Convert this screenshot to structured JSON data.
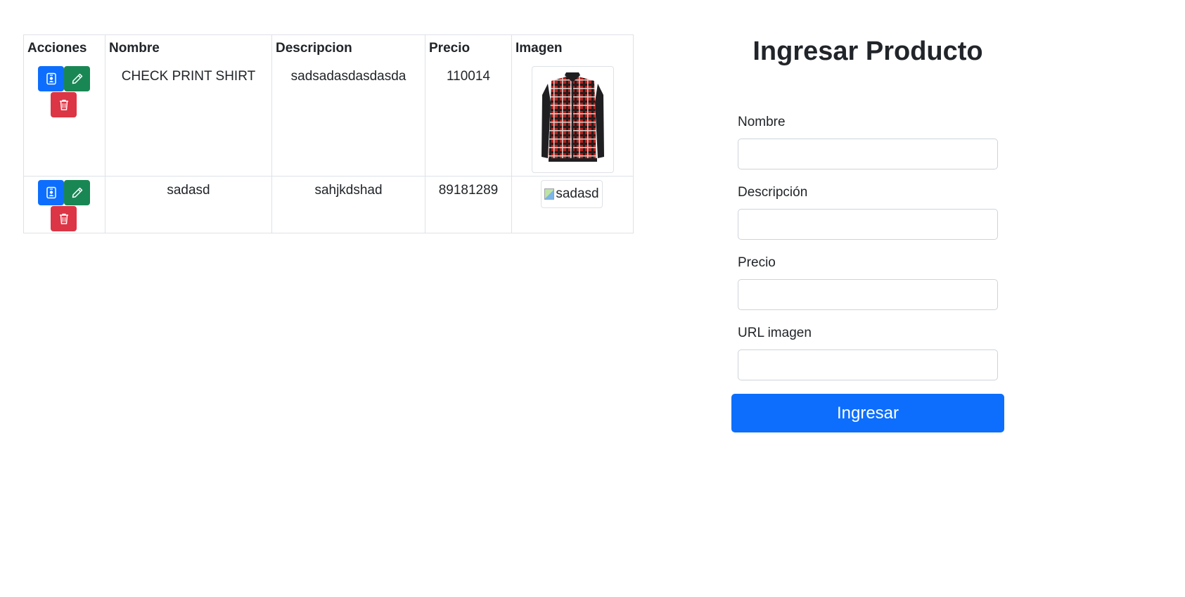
{
  "table": {
    "headers": {
      "acciones": "Acciones",
      "nombre": "Nombre",
      "descripcion": "Descripcion",
      "precio": "Precio",
      "imagen": "Imagen"
    },
    "rows": [
      {
        "nombre": "CHECK PRINT SHIRT",
        "descripcion": "sadsadasdasdasda",
        "precio": "110014",
        "image_alt": "",
        "image_kind": "plaid-shirt"
      },
      {
        "nombre": "sadasd",
        "descripcion": "sahjkdshad",
        "precio": "89181289",
        "image_alt": "sadasd",
        "image_kind": "broken-image"
      }
    ],
    "action_icons": {
      "view": "person-badge-icon",
      "edit": "pencil-icon",
      "delete": "trash-icon"
    }
  },
  "form": {
    "title": "Ingresar Producto",
    "fields": [
      {
        "label": "Nombre",
        "value": "",
        "placeholder": ""
      },
      {
        "label": "Descripción",
        "value": "",
        "placeholder": ""
      },
      {
        "label": "Precio",
        "value": "",
        "placeholder": ""
      },
      {
        "label": "URL imagen",
        "value": "",
        "placeholder": ""
      }
    ],
    "submit_label": "Ingresar"
  },
  "colors": {
    "primary": "#0d6efd",
    "success": "#198754",
    "danger": "#dc3545",
    "border": "#dee2e6"
  }
}
